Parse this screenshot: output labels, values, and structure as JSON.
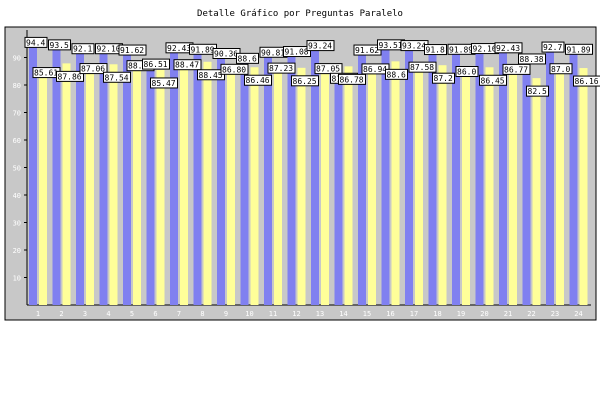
{
  "chart_data": {
    "type": "bar",
    "title": "Detalle Gráfico por Preguntas Paralelo",
    "xlabel": "",
    "ylabel": "",
    "ylim": [
      0,
      100
    ],
    "yticks": [
      10,
      20,
      30,
      40,
      50,
      60,
      70,
      80,
      90
    ],
    "grid": false,
    "legend": "none",
    "categories": [
      "1",
      "2",
      "3",
      "4",
      "5",
      "6",
      "7",
      "8",
      "9",
      "10",
      "11",
      "12",
      "13",
      "14",
      "15",
      "16",
      "17",
      "18",
      "19",
      "20",
      "21",
      "22",
      "23",
      "24"
    ],
    "series": [
      {
        "color": "#8080f0",
        "values": [
          94.4,
          93.5,
          92.1,
          92.1,
          91.62,
          86.51,
          92.43,
          91.89,
          90.36,
          88.6,
          90.81,
          91.08,
          93.24,
          81.35,
          91.62,
          93.51,
          93.24,
          91.8,
          91.89,
          92.16,
          92.43,
          88.38,
          92.7,
          91.89
        ],
        "labels": [
          "94.4",
          "93.5",
          "92.1",
          "92.10",
          "91.62",
          "86.51",
          "92.43",
          "91.89",
          "90.36",
          "88.6",
          "90.81",
          "91.08",
          "93.24",
          "81.35",
          "91.62",
          "93.51",
          "93.24",
          "91.8",
          "91.89",
          "92.16",
          "92.43",
          "88.38",
          "92.7",
          "91.89"
        ]
      },
      {
        "color": "#ffff99",
        "values": [
          85.61,
          87.86,
          87.06,
          87.54,
          88.11,
          85.47,
          88.47,
          88.45,
          86.8,
          86.46,
          87.23,
          86.25,
          87.05,
          86.78,
          86.94,
          88.6,
          87.58,
          87.2,
          86.0,
          86.45,
          86.77,
          82.5,
          87.0,
          86.16
        ],
        "labels": [
          "85.61",
          "87.86",
          "87.06",
          "87.54",
          "88.11",
          "85.47",
          "88.47",
          "88.45",
          "86.80",
          "86.46",
          "87.23",
          "86.25",
          "87.05",
          "86.78",
          "86.94",
          "88.6",
          "87.58",
          "87.2",
          "86.0",
          "86.45",
          "86.77",
          "82.5",
          "87.0",
          "86.16"
        ]
      }
    ]
  }
}
